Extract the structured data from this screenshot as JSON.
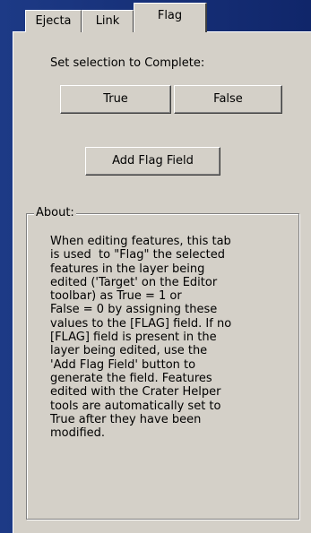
{
  "tabs": [
    {
      "label": "Ejecta",
      "active": false
    },
    {
      "label": "Link",
      "active": false
    },
    {
      "label": "Flag",
      "active": true
    }
  ],
  "flag_panel": {
    "caption": "Set selection to Complete:",
    "true_button": "True",
    "false_button": "False",
    "add_flag_button": "Add Flag Field"
  },
  "about": {
    "title": "About:",
    "text": "When editing features, this tab\nis used  to \"Flag\" the selected\nfeatures in the layer being\nedited ('Target' on the Editor\ntoolbar) as True = 1 or\nFalse = 0 by assigning these\nvalues to the [FLAG] field. If no\n[FLAG] field is present in the\nlayer being edited, use the\n'Add Flag Field' button to\ngenerate the field. Features\nedited with the Crater Helper\ntools are automatically set to\nTrue after they have been\nmodified."
  },
  "colors": {
    "background": "#1d3a86",
    "panel": "#d4d0c8"
  }
}
